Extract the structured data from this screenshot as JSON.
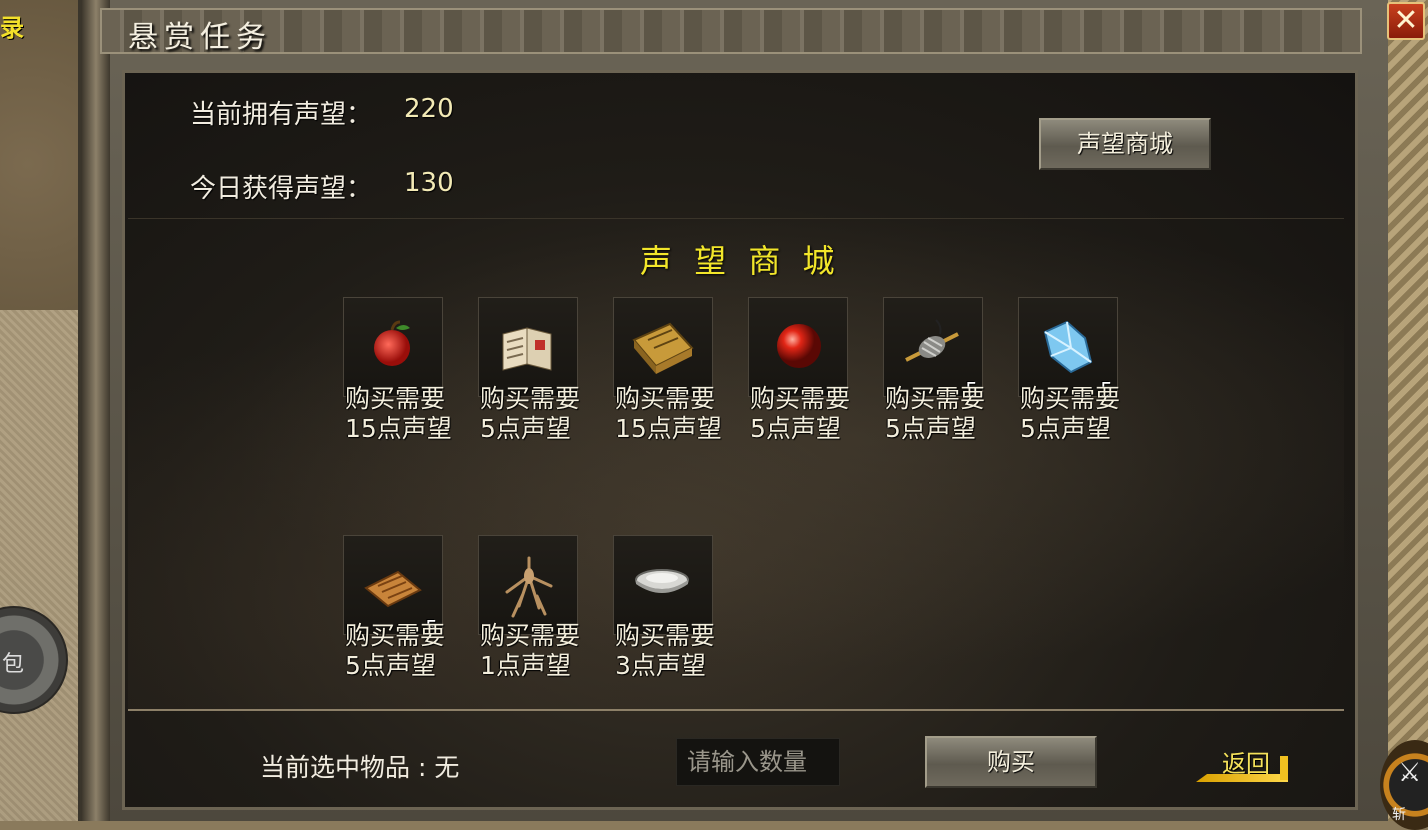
{
  "window": {
    "title": "悬赏任务",
    "close_symbol": "✕"
  },
  "world": {
    "corner_label": "录",
    "round_button_label": "包"
  },
  "reputation": {
    "current_label": "当前拥有声望：",
    "current_value": "220",
    "today_label": "今日获得声望：",
    "today_value": "130",
    "shop_button_label": "声望商城"
  },
  "shop": {
    "title": "声 望 商 城",
    "items": [
      {
        "icon": "red-apple-icon",
        "count": "",
        "price_line1": "购买需要",
        "price_line2": "15点声望"
      },
      {
        "icon": "open-book-icon",
        "count": "",
        "price_line1": "购买需要",
        "price_line2": "5点声望"
      },
      {
        "icon": "golden-tome-icon",
        "count": "",
        "price_line1": "购买需要",
        "price_line2": "15点声望"
      },
      {
        "icon": "red-gem-orb-icon",
        "count": "",
        "price_line1": "购买需要",
        "price_line2": "5点声望"
      },
      {
        "icon": "spindle-icon",
        "count": "5",
        "price_line1": "购买需要",
        "price_line2": "5点声望"
      },
      {
        "icon": "blue-crystal-icon",
        "count": "5",
        "price_line1": "购买需要",
        "price_line2": "5点声望"
      },
      {
        "icon": "scroll-bundle-icon",
        "count": "5",
        "price_line1": "购买需要",
        "price_line2": "5点声望"
      },
      {
        "icon": "ginseng-root-icon",
        "count": "",
        "price_line1": "购买需要",
        "price_line2": "1点声望"
      },
      {
        "icon": "silver-ingot-icon",
        "count": "",
        "price_line1": "购买需要",
        "price_line2": "3点声望"
      }
    ]
  },
  "footer": {
    "selected_label": "当前选中物品 : 无",
    "quantity_placeholder": "请输入数量",
    "buy_button_label": "购买",
    "back_button_label": "返回"
  },
  "hud": {
    "skill_label": "斩"
  }
}
